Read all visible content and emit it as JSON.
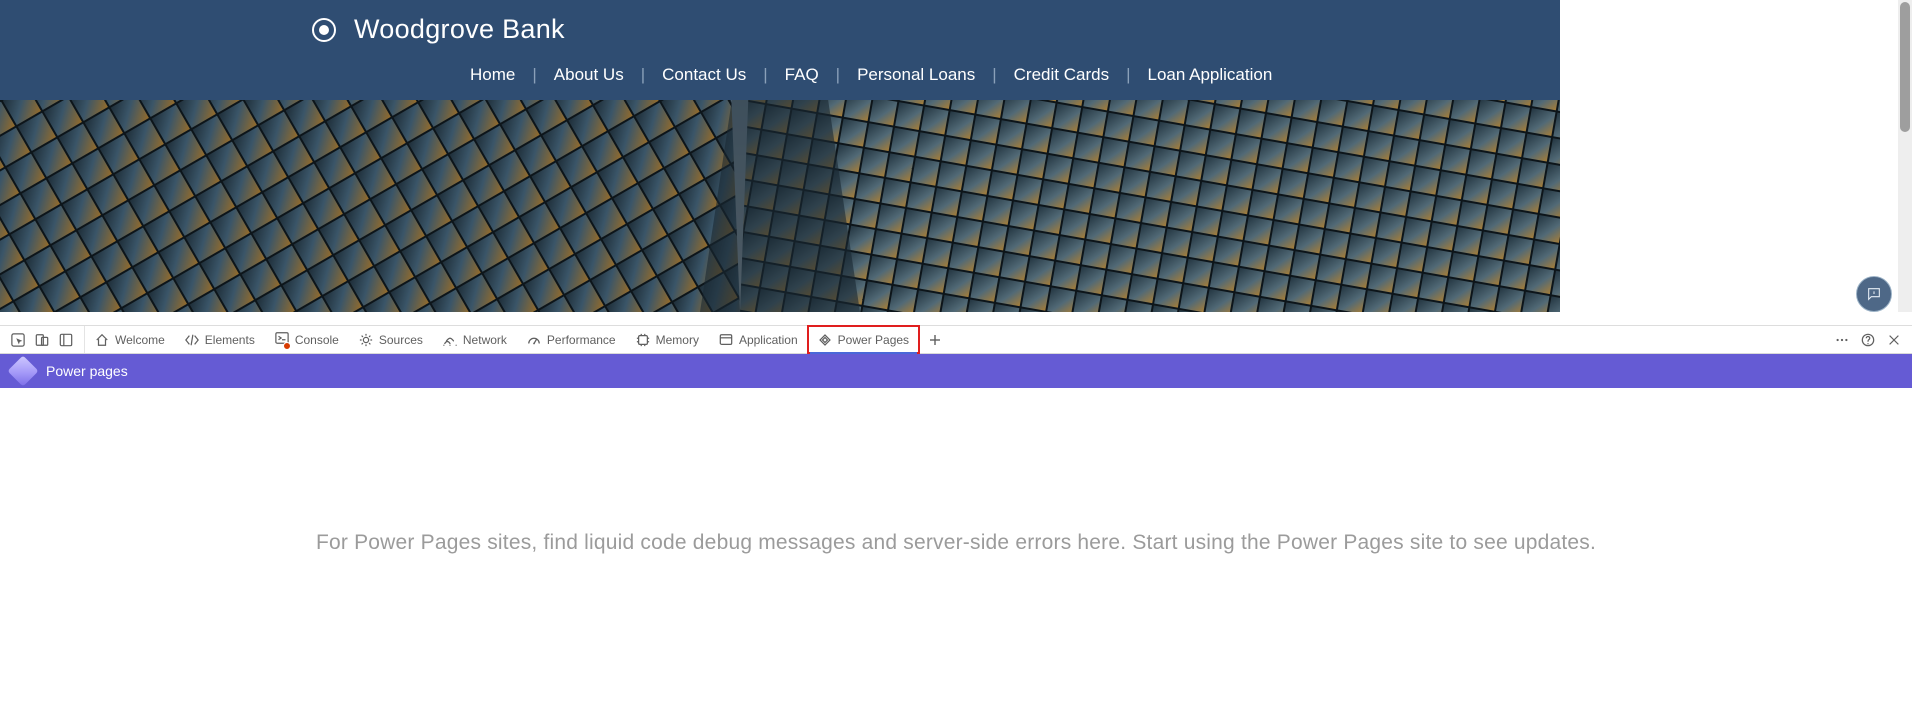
{
  "site": {
    "brand_name": "Woodgrove Bank",
    "nav": [
      "Home",
      "About Us",
      "Contact Us",
      "FAQ",
      "Personal Loans",
      "Credit Cards",
      "Loan Application"
    ]
  },
  "devtools": {
    "tabs": {
      "welcome": "Welcome",
      "elements": "Elements",
      "console": "Console",
      "sources": "Sources",
      "network": "Network",
      "performance": "Performance",
      "memory": "Memory",
      "application": "Application",
      "power_pages": "Power Pages"
    }
  },
  "power_pages_panel": {
    "title": "Power pages",
    "message": "For Power Pages sites, find liquid code debug messages and server-side errors here. Start using the Power Pages site to see updates."
  }
}
